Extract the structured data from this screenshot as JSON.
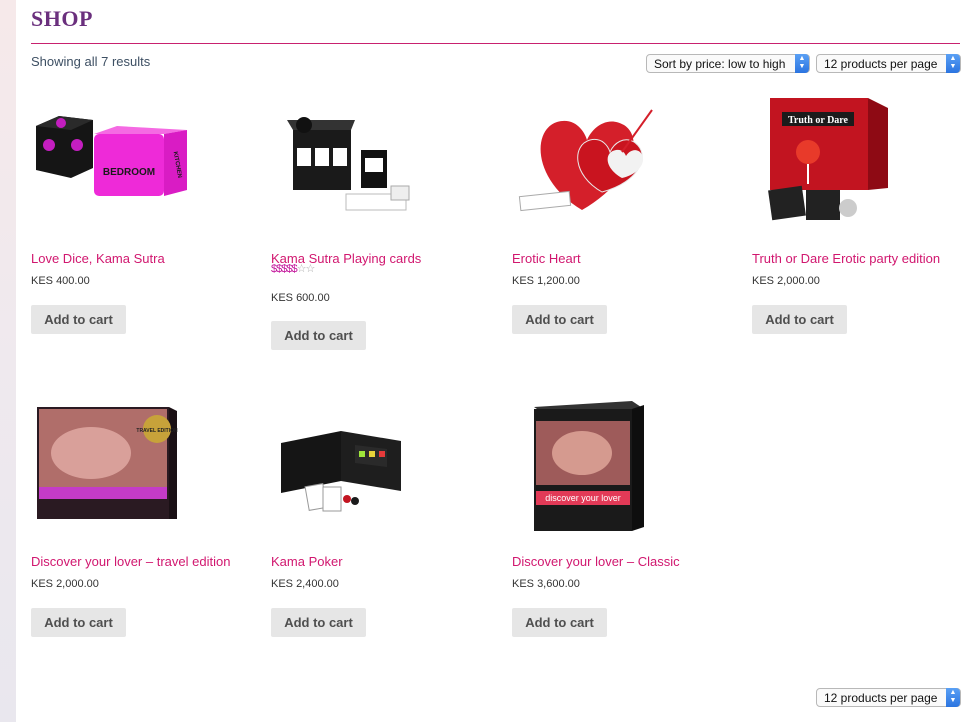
{
  "page": {
    "title": "SHOP",
    "result_count": "Showing all 7 results"
  },
  "controls": {
    "sort_selected": "Sort by price: low to high",
    "per_page_selected": "12 products per page",
    "per_page_bottom_selected": "12 products per page"
  },
  "products": [
    {
      "name": "Love Dice, Kama Sutra",
      "price": "KES 400.00",
      "button": "Add to cart"
    },
    {
      "name": "Kama Sutra Playing cards",
      "price": "KES 600.00",
      "button": "Add to cart",
      "rating_text": "$$$$$",
      "rating_stars": "☆☆"
    },
    {
      "name": "Erotic Heart",
      "price": "KES 1,200.00",
      "button": "Add to cart"
    },
    {
      "name": "Truth or Dare Erotic party edition",
      "price": "KES 2,000.00",
      "button": "Add to cart"
    },
    {
      "name": "Discover your lover – travel edition",
      "price": "KES 2,000.00",
      "button": "Add to cart"
    },
    {
      "name": "Kama Poker",
      "price": "KES 2,400.00",
      "button": "Add to cart"
    },
    {
      "name": "Discover your lover – Classic",
      "price": "KES 3,600.00",
      "button": "Add to cart"
    }
  ],
  "image_text": {
    "dice_face_1": "BEDROOM",
    "dice_face_2": "KITCHEN",
    "truth_dare_logo": "Truth or Dare",
    "discover_lover_text": "discover your lover",
    "travel_badge": "TRAVEL EDITION"
  },
  "colors": {
    "title": "#6a2f7d",
    "accent": "#c8216f",
    "link": "#d1176f",
    "button_bg": "#e6e6e6",
    "select_arrow": "#2b74e0"
  }
}
